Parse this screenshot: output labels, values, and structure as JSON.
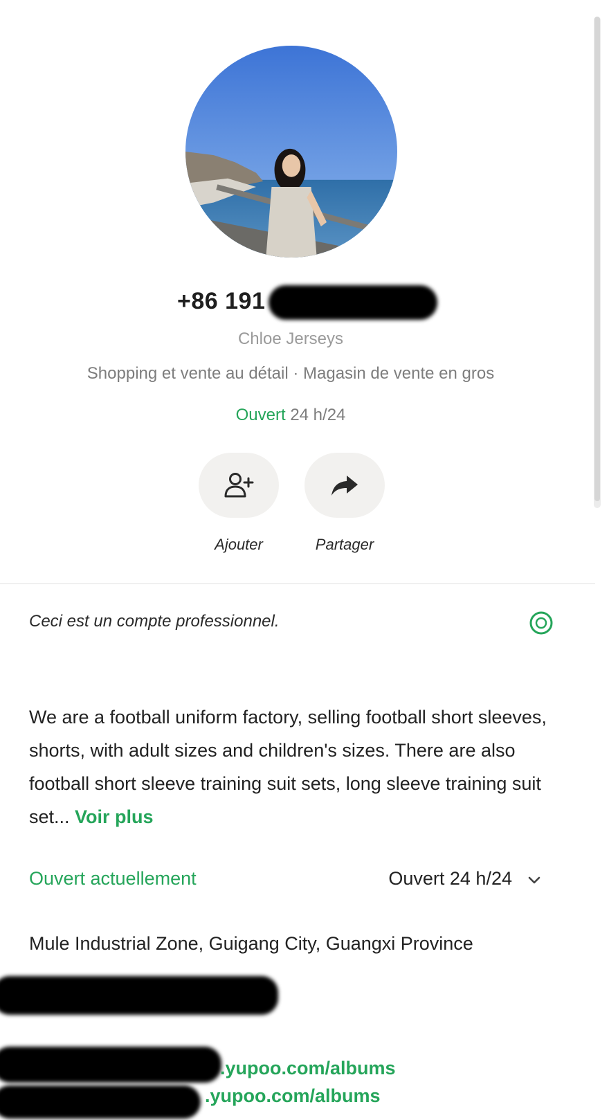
{
  "profile": {
    "phone_visible": "+86 191",
    "business_name": "Chloe Jerseys",
    "category": "Shopping et vente au détail · Magasin de vente en gros",
    "hours_status_open": "Ouvert",
    "hours_status_rest": "24 h/24"
  },
  "actions": [
    {
      "label": "Ajouter",
      "icon": "add-contact-icon"
    },
    {
      "label": "Partager",
      "icon": "share-arrow-icon"
    }
  ],
  "business_info": {
    "notice": "Ceci est un compte professionnel.",
    "notice_icon": "info-icon",
    "description": "We are a football uniform factory, selling football short sleeves, shorts, with adult sizes and children's sizes. There are also football short sleeve training suit sets, long sleeve training suit set...",
    "see_more": "Voir plus",
    "open_now": "Ouvert actuellement",
    "hours": "Ouvert 24 h/24",
    "address": "Mule Industrial Zone, Guigang City, Guangxi Province",
    "links": [
      ".yupoo.com/albums",
      ".yupoo.com/albums"
    ]
  },
  "colors": {
    "accent_green": "#25a55a",
    "background": "#ffffff",
    "button_bg": "#f2f1ef"
  }
}
